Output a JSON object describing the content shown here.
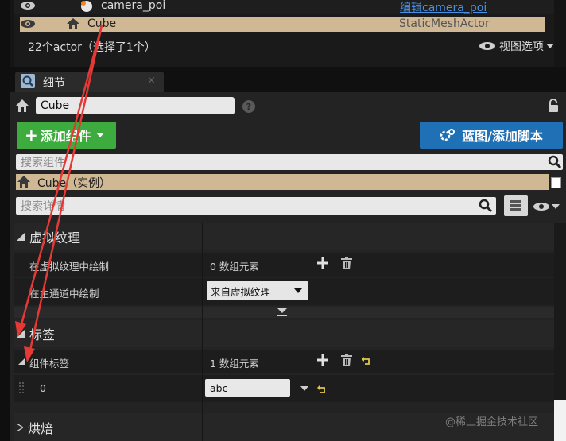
{
  "outliner": {
    "row1": {
      "name": "camera_poi",
      "type_link": "编辑camera_poi"
    },
    "row2": {
      "name": "Cube",
      "type": "StaticMeshActor"
    },
    "actor_count": "22个actor（选择了1个）",
    "view_options": "视图选项"
  },
  "details_tab": {
    "title": "细节",
    "close": "×"
  },
  "name_field": {
    "value": "Cube"
  },
  "add_component_button": {
    "label": "添加组件"
  },
  "blueprint_button": {
    "label": "蓝图/添加脚本"
  },
  "search_components": {
    "placeholder": "搜索组件"
  },
  "component_item": {
    "label": "Cube（实例）"
  },
  "search_details": {
    "placeholder": "搜索详情"
  },
  "sections": {
    "virtual_texture": {
      "title": "虚拟纹理",
      "rows": [
        {
          "label": "在虚拟纹理中绘制",
          "value": "0 数组元素"
        },
        {
          "label": "在主通道中绘制",
          "value": "来自虚拟纹理"
        }
      ]
    },
    "tags": {
      "title": "标签",
      "component_tags_label": "组件标签",
      "component_tags_value": "1 数组元素",
      "element_index": "0",
      "element_value": "abc"
    },
    "bake": {
      "title": "烘焙"
    }
  },
  "watermark": "@稀土掘金技术社区",
  "colors": {
    "accent_green": "#3dab3d",
    "accent_blue": "#1f70b5",
    "selection": "#d0b894",
    "link": "#4a90e2",
    "arrow": "#e53935"
  }
}
